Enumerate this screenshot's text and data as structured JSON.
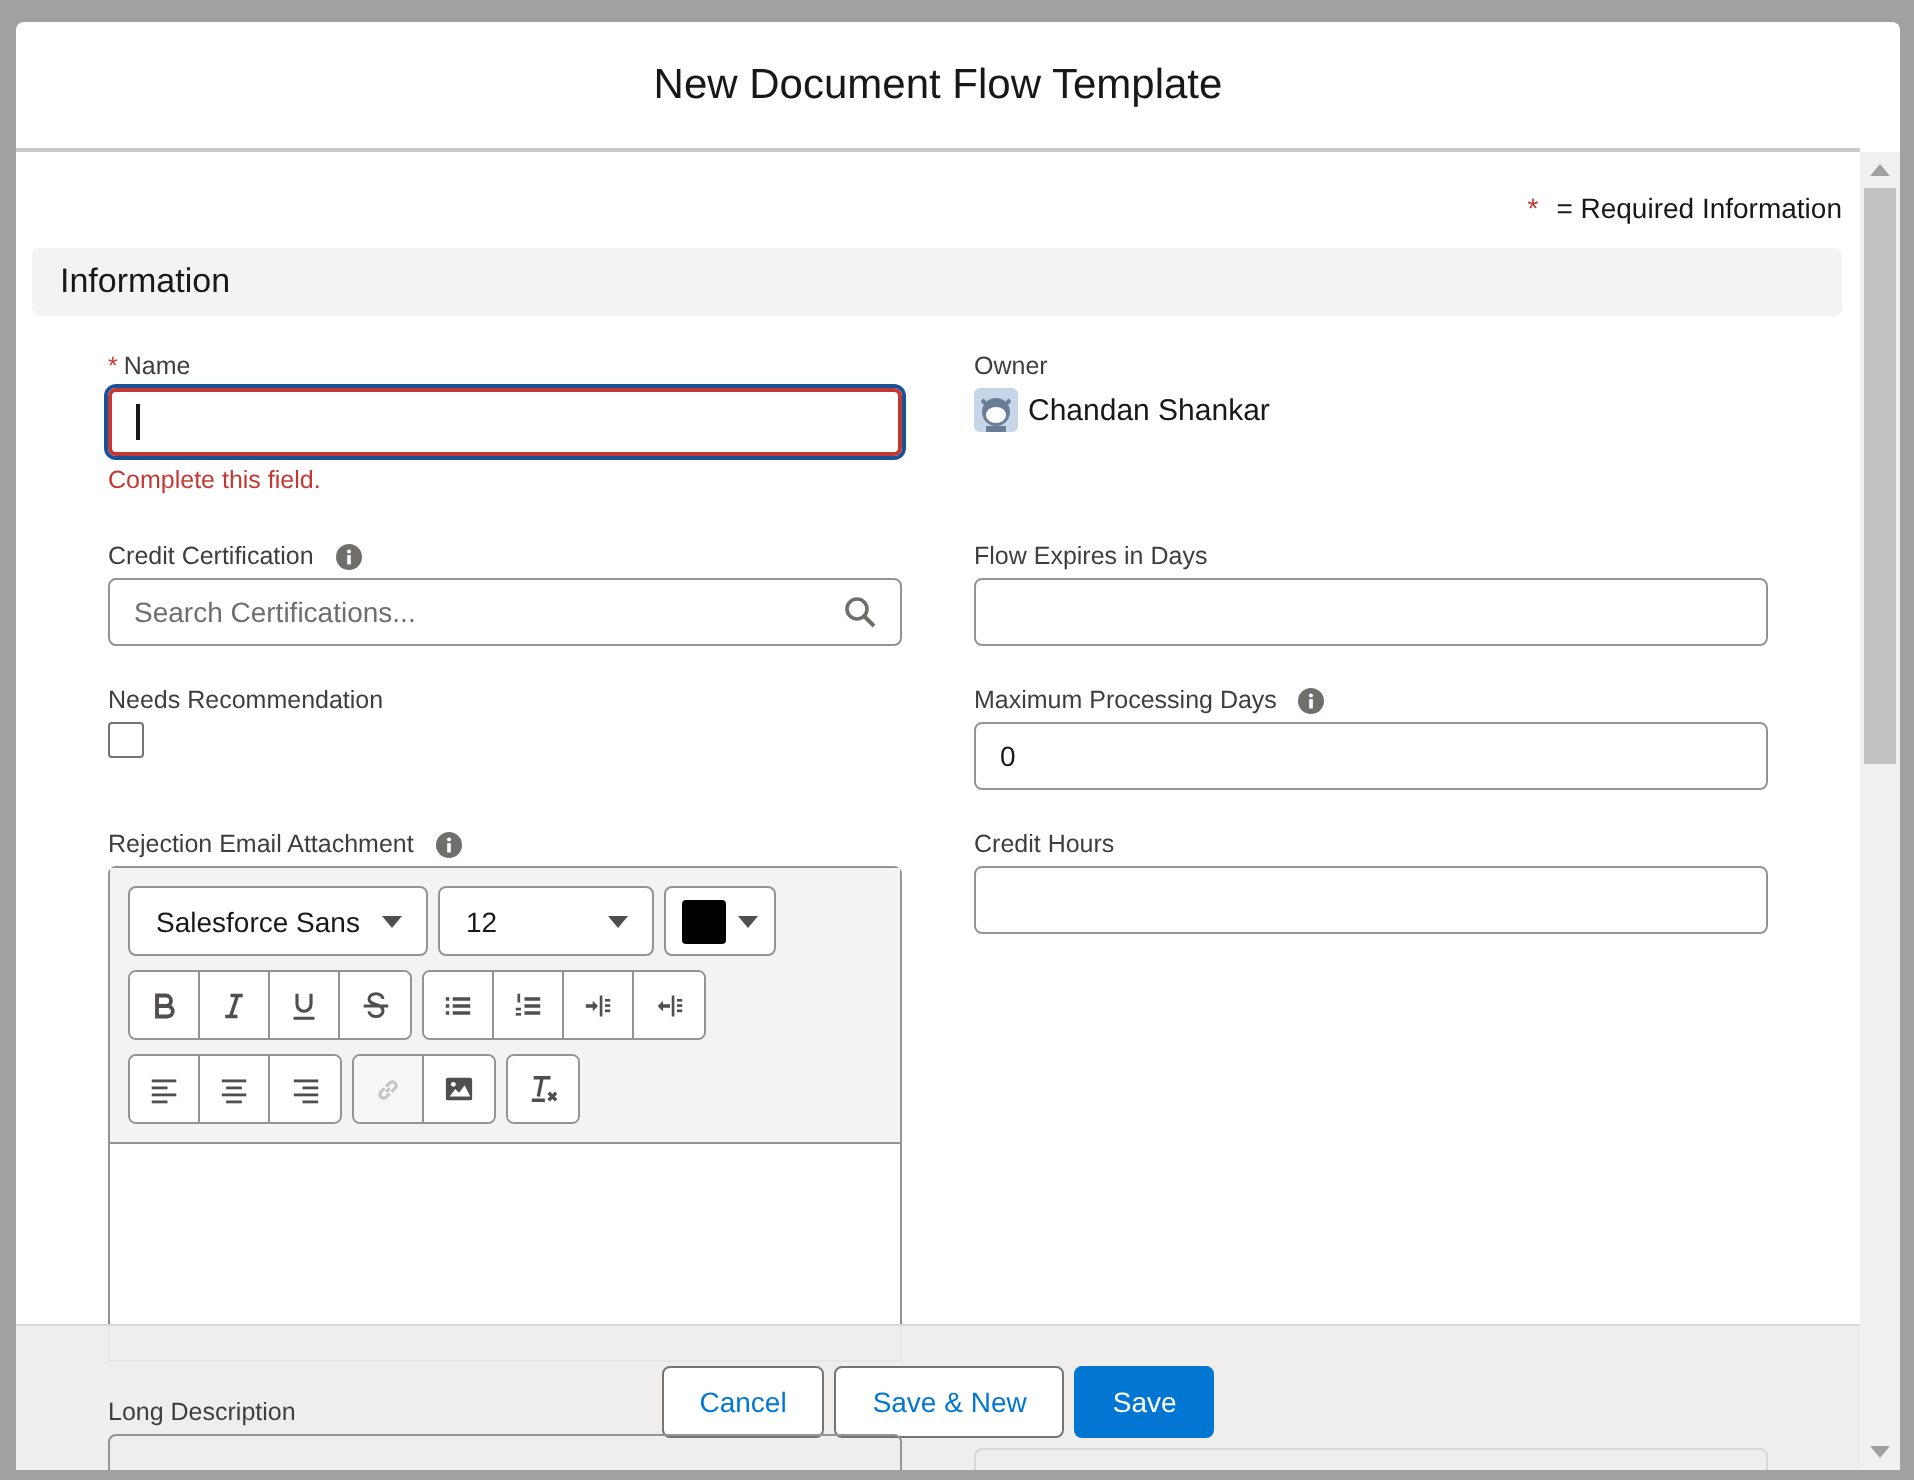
{
  "modal": {
    "title": "New Document Flow Template",
    "required_marker": "*",
    "required_note": "= Required Information"
  },
  "section": {
    "title": "Information"
  },
  "left_fields": [
    {
      "kind": "text",
      "label": "Name",
      "required": true,
      "invalid": true,
      "focused": true,
      "error": "Complete this field."
    },
    {
      "kind": "lookup",
      "label": "Credit Certification",
      "info": true,
      "placeholder": "Search Certifications..."
    },
    {
      "kind": "checkbox",
      "label": "Needs Recommendation",
      "checked": false
    },
    {
      "kind": "richtext",
      "label": "Rejection Email Attachment",
      "info": true,
      "font": "Salesforce Sans",
      "size": "12",
      "toolbar": [
        [
          {
            "kind": "bold",
            "disabled": false
          },
          {
            "kind": "italic",
            "disabled": false
          },
          {
            "kind": "underline",
            "disabled": false
          },
          {
            "kind": "strike",
            "disabled": false
          }
        ],
        [
          {
            "kind": "bullets",
            "disabled": false
          },
          {
            "kind": "numbers",
            "disabled": false
          },
          {
            "kind": "indent",
            "disabled": false
          },
          {
            "kind": "outdent",
            "disabled": false
          }
        ],
        [
          {
            "kind": "align-left",
            "disabled": false
          },
          {
            "kind": "align-center",
            "disabled": false
          },
          {
            "kind": "align-right",
            "disabled": false
          }
        ],
        [
          {
            "kind": "link",
            "disabled": true
          },
          {
            "kind": "image",
            "disabled": false
          }
        ],
        [
          {
            "kind": "clear",
            "disabled": false
          }
        ]
      ]
    },
    {
      "kind": "text",
      "label": "Long Description"
    }
  ],
  "right_fields": [
    {
      "kind": "owner",
      "label": "Owner",
      "value": "Chandan Shankar"
    },
    {
      "kind": "text",
      "label": "Flow Expires in Days"
    },
    {
      "kind": "text",
      "label": "Maximum Processing Days",
      "info": true,
      "value": "0"
    },
    {
      "kind": "text",
      "label": "Credit Hours"
    }
  ],
  "footer": {
    "buttons": [
      {
        "label": "Cancel",
        "kind": "neutral"
      },
      {
        "label": "Save & New",
        "kind": "neutral"
      },
      {
        "label": "Save",
        "kind": "brand"
      }
    ]
  }
}
